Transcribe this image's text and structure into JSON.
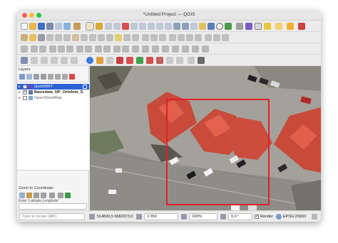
{
  "window": {
    "title": "*Untitled Project — QGIS"
  },
  "colors": {
    "selection": "#2a62d4",
    "roof": "#d44c3c",
    "bbox": "#e0202a",
    "pavement": "#9a9890"
  },
  "toolbar_icons": [
    "new-project-icon",
    "open-project-icon",
    "save-project-icon",
    "print-layout-icon",
    "pan-icon",
    "zoom-in-icon",
    "zoom-out-icon",
    "identify-icon",
    "measure-icon",
    "refresh-icon",
    "add-layer-icon",
    "python-icon"
  ],
  "layers_panel": {
    "title": "Layers",
    "items": [
      {
        "label": "QuickWKT",
        "checked": true,
        "selected": true
      },
      {
        "label": "Basisdata_NP_Ortofoto_S",
        "checked": true,
        "selected": false
      },
      {
        "label": "OpenStreetMap",
        "checked": false,
        "selected": false
      }
    ]
  },
  "zoom_panel": {
    "title": "Zoom to Coordinate",
    "format_label": "Enter 'Latitude,Longitude'",
    "input_value": ""
  },
  "statusbar": {
    "locator_placeholder": "Type to locate (⌘K)",
    "coordinate": "514839,5  6682973,0",
    "scale": "1:350",
    "magnifier": "100%",
    "rotation": "0,0 °",
    "render_label": "Render",
    "crs": "EPSG:25833"
  }
}
